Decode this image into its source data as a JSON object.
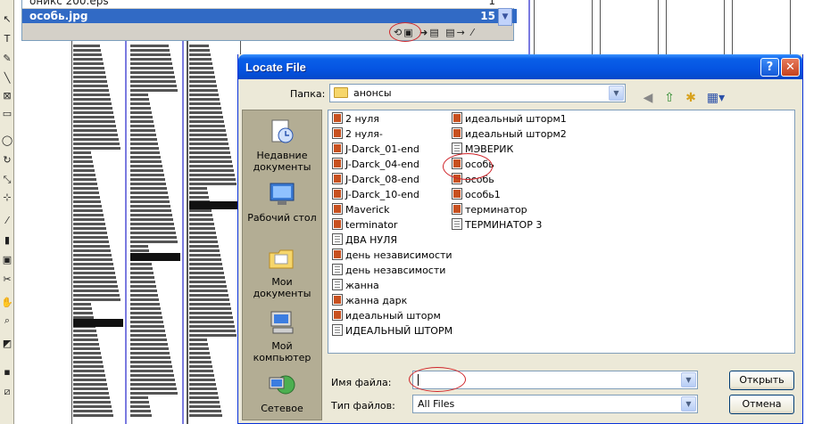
{
  "links_panel": {
    "prev_row": "оникс 200.eps",
    "prev_count": "1",
    "selected_row": "особь.jpg",
    "selected_count": "15"
  },
  "dialog": {
    "title": "Locate File",
    "help_glyph": "?",
    "close_glyph": "✕",
    "lookin_label": "Папка:",
    "lookin_value": "анонсы",
    "places": [
      {
        "label": "Недавние документы",
        "icon": "recent-documents-icon"
      },
      {
        "label": "Рабочий стол",
        "icon": "desktop-icon"
      },
      {
        "label": "Мои документы",
        "icon": "my-documents-icon"
      },
      {
        "label": "Мой компьютер",
        "icon": "my-computer-icon"
      },
      {
        "label": "Сетевое",
        "icon": "network-icon"
      }
    ],
    "files_col1": [
      {
        "name": "2 нуля",
        "kind": "doc"
      },
      {
        "name": "2 нуля-",
        "kind": "doc"
      },
      {
        "name": "J-Darck_01-end",
        "kind": "doc"
      },
      {
        "name": "J-Darck_04-end",
        "kind": "doc"
      },
      {
        "name": "J-Darck_08-end",
        "kind": "doc"
      },
      {
        "name": "J-Darck_10-end",
        "kind": "doc"
      },
      {
        "name": "Maverick",
        "kind": "doc"
      },
      {
        "name": "terminator",
        "kind": "doc"
      },
      {
        "name": "ДВА НУЛЯ",
        "kind": "txt"
      },
      {
        "name": "день независимости",
        "kind": "doc"
      },
      {
        "name": "день незавсимости",
        "kind": "txt"
      },
      {
        "name": "жанна",
        "kind": "txt"
      },
      {
        "name": "жанна дарк",
        "kind": "doc"
      },
      {
        "name": "идеальный шторм",
        "kind": "doc"
      },
      {
        "name": "ИДЕАЛЬНЫЙ ШТОРМ",
        "kind": "txt"
      }
    ],
    "files_col2": [
      {
        "name": "идеальный шторм1",
        "kind": "doc"
      },
      {
        "name": "идеальный шторм2",
        "kind": "doc"
      },
      {
        "name": "МЭВЕРИК",
        "kind": "txt"
      },
      {
        "name": "особь",
        "kind": "doc"
      },
      {
        "name": "особь",
        "kind": "doc"
      },
      {
        "name": "особь1",
        "kind": "doc"
      },
      {
        "name": "терминатор",
        "kind": "doc"
      },
      {
        "name": "ТЕРМИНАТОР 3",
        "kind": "txt"
      }
    ],
    "filename_label": "Имя файла:",
    "filename_value": "",
    "filetype_label": "Тип файлов:",
    "filetype_value": "All Files",
    "open_label": "Открыть",
    "cancel_label": "Отмена"
  },
  "colors": {
    "titlebar": "#0554e2",
    "selection": "#316ac5",
    "annotation": "#d0262b"
  }
}
